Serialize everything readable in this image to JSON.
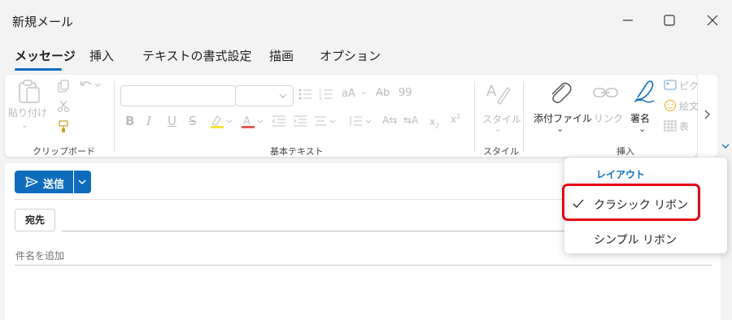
{
  "window": {
    "title": "新規メール"
  },
  "tabs": [
    {
      "label": "メッセージ",
      "active": true
    },
    {
      "label": "挿入"
    },
    {
      "label": "テキストの書式設定"
    },
    {
      "label": "描画"
    },
    {
      "label": "オプション"
    }
  ],
  "ribbon": {
    "paste_label": "貼り付け",
    "groups": {
      "clipboard": "クリップボード",
      "basic_text": "基本テキスト",
      "style": "スタイル",
      "insert": "挿入"
    },
    "style_label": "スタイル",
    "attach_label": "添付ファイル",
    "link_label": "リンク",
    "signature_label": "署名",
    "truncated_items": [
      "ピク",
      "絵文",
      "表"
    ]
  },
  "compose": {
    "send_label": "送信",
    "to_label": "宛先",
    "subject_placeholder": "件名を追加"
  },
  "layout_menu": {
    "header": "レイアウト",
    "items": [
      {
        "label": "クラシック リボン",
        "checked": true
      },
      {
        "label": "シンプル リボン",
        "checked": false
      }
    ]
  },
  "colors": {
    "accent": "#0f6cbd",
    "highlight_border": "#e60012"
  }
}
